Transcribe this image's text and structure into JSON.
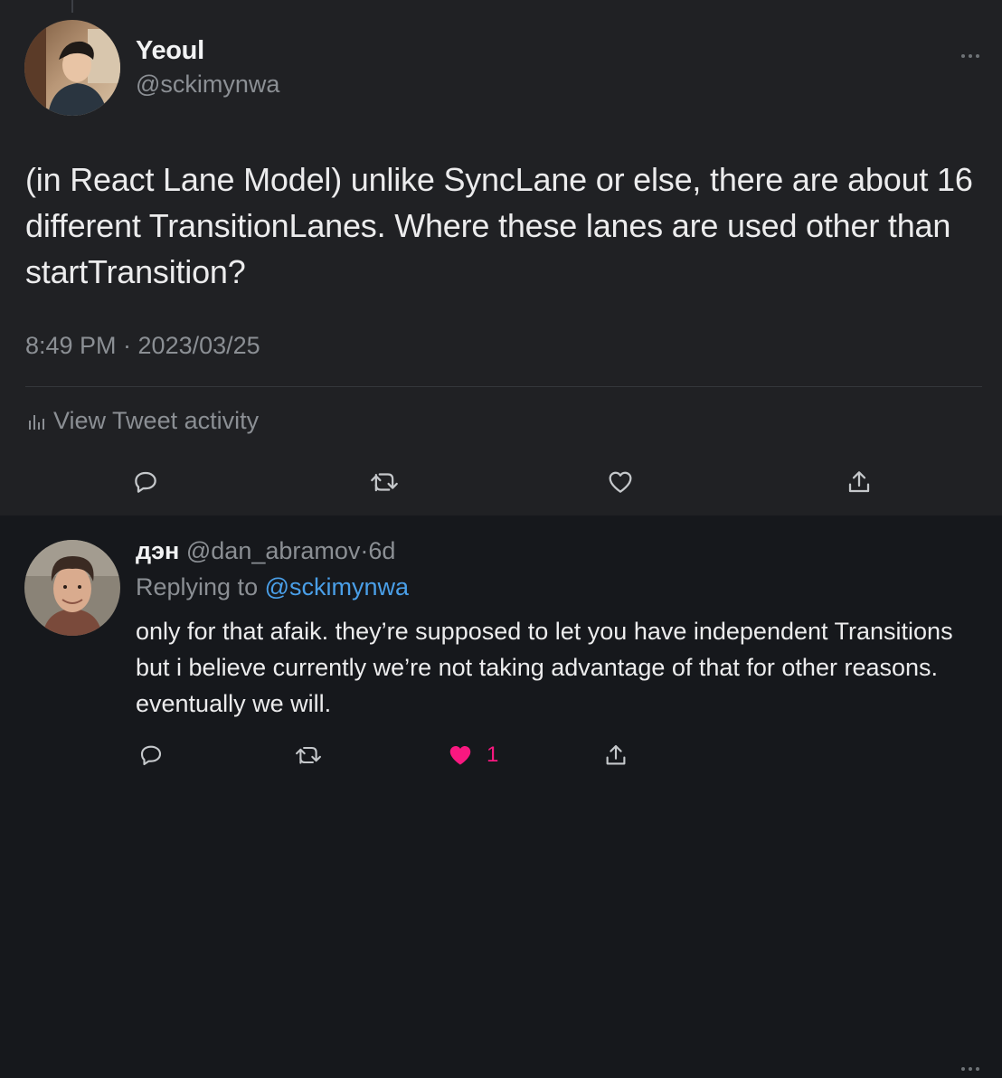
{
  "main_tweet": {
    "author_name": "Yeoul",
    "author_handle": "@sckimynwa",
    "text": "(in React Lane Model) unlike SyncLane or else, there are about 16 different TransitionLanes. Where these lanes are used other than startTransition?",
    "timestamp": "8:49 PM · 2023/03/25",
    "activity_label": "View Tweet activity",
    "icons": [
      "reply-icon",
      "retweet-icon",
      "like-icon",
      "share-icon",
      "more-icon",
      "analytics-icon"
    ]
  },
  "reply": {
    "author_name": "дэн",
    "author_handle": "@dan_abramov",
    "separator": "·",
    "time": "6d",
    "replying_prefix": "Replying to",
    "replying_handle": "@sckimynwa",
    "text": "only for that afaik. they’re supposed to let you have independent Transitions but i believe currently we’re not taking advantage of that for other reasons. eventually we will.",
    "like_count": "1",
    "liked": true
  },
  "colors": {
    "main_background": "#202124",
    "reply_background": "#16181c",
    "link": "#4a9fe8",
    "like_active": "#f91880",
    "secondary_text": "#8b8f94"
  }
}
